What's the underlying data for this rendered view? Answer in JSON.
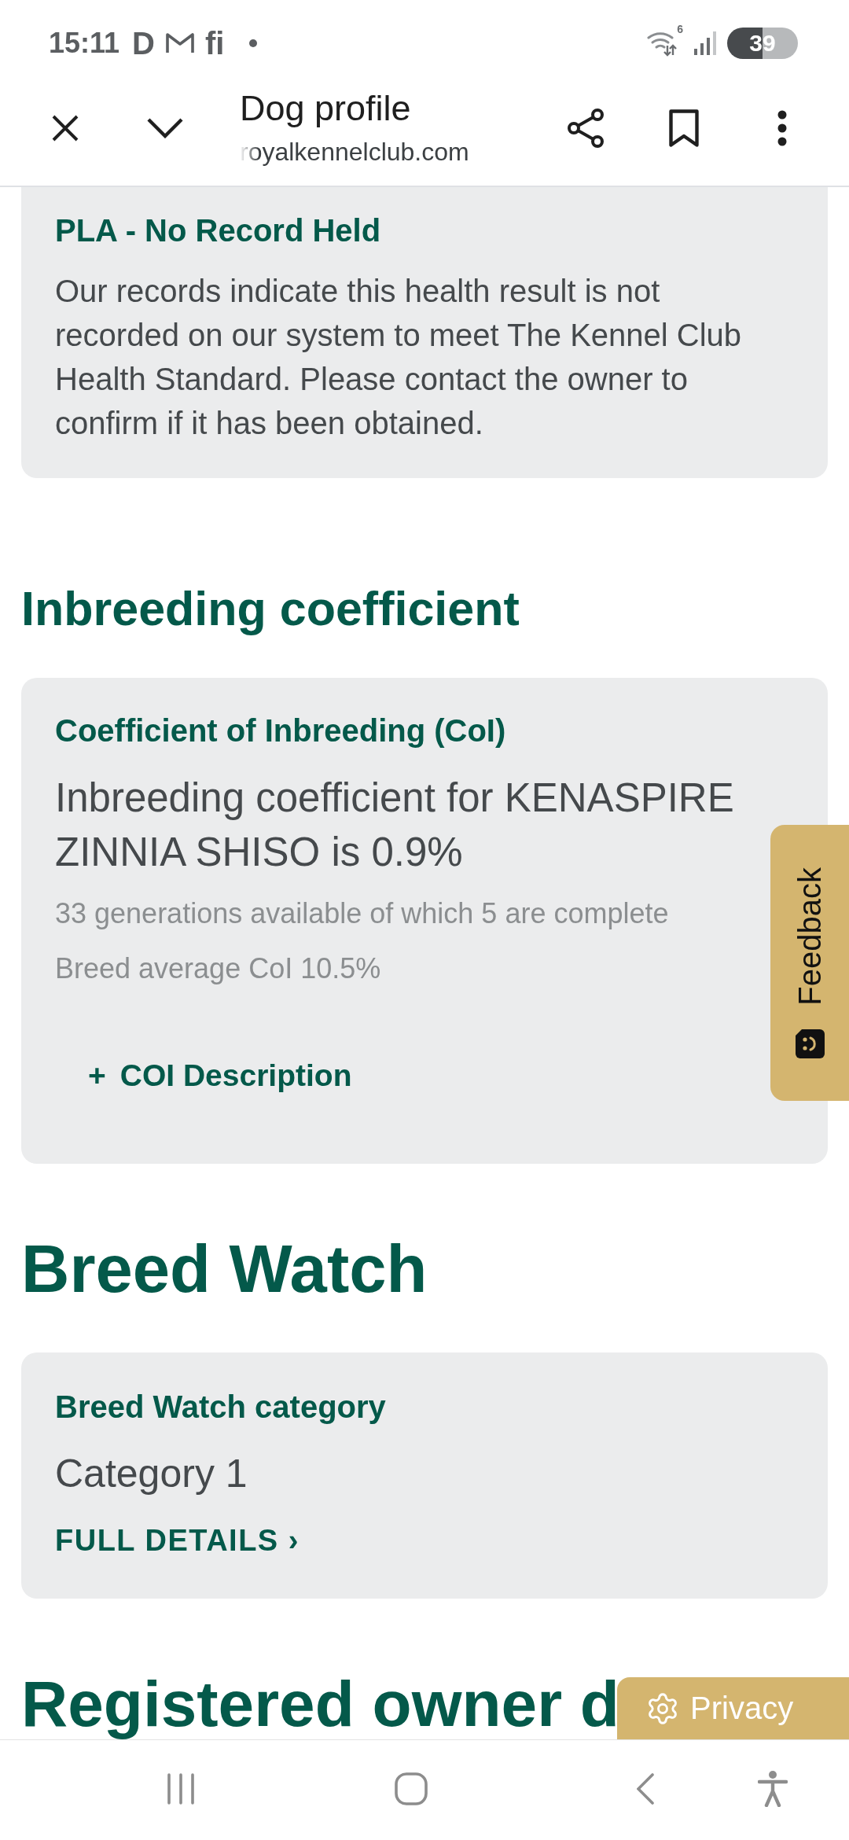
{
  "status_bar": {
    "time": "15:11",
    "notifications": [
      {
        "kind": "glyph",
        "text": "D"
      },
      {
        "kind": "mail"
      },
      {
        "kind": "glyph",
        "text": "fi"
      },
      {
        "kind": "dot"
      }
    ],
    "wifi_badge": "6",
    "battery": "39"
  },
  "browser_bar": {
    "title": "Dog profile",
    "url": "royalkennelclub.com"
  },
  "health_result": {
    "title": "PLA - No Record Held",
    "text": "Our records indicate this health result is not recorded on our system to meet The Kennel Club Health Standard. Please contact the owner to confirm if it has been obtained."
  },
  "inbreeding": {
    "heading": "Inbreeding coefficient",
    "card_title": "Coefficient of Inbreeding (CoI)",
    "result": "Inbreeding coefficient for KENASPIRE ZINNIA SHISO is 0.9%",
    "generations": "33 generations available of which 5 are complete",
    "breed_average": "Breed average CoI 10.5%",
    "description_button": {
      "symbol": "+",
      "label": "COI Description"
    }
  },
  "breed_watch": {
    "heading": "Breed Watch",
    "card_title": "Breed Watch category",
    "value": "Category 1",
    "link": "FULL DETAILS ›"
  },
  "next_heading": "Registered owner d",
  "feedback_tab": {
    "label": "Feedback"
  },
  "privacy_button": {
    "label": "Privacy"
  }
}
